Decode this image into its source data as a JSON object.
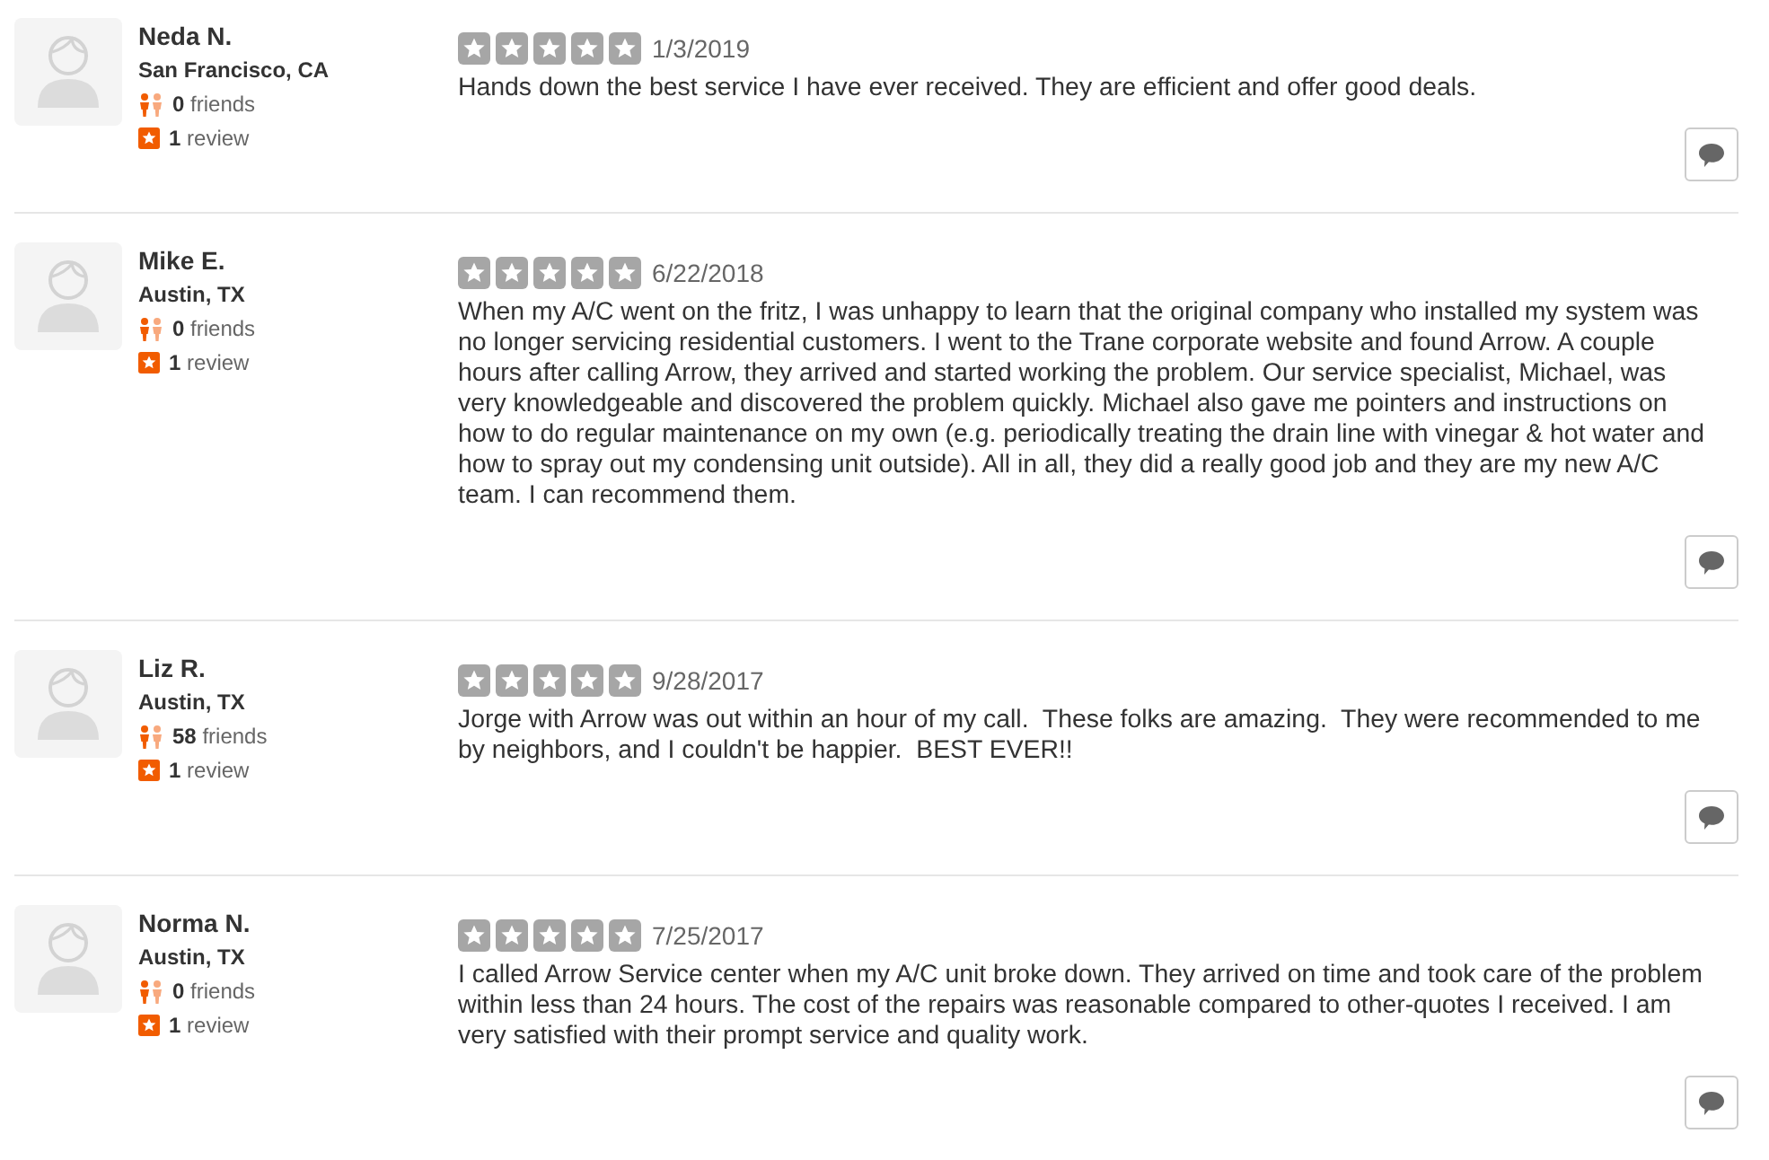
{
  "reviews": [
    {
      "user": {
        "name": "Neda N.",
        "location": "San Francisco, CA",
        "friends": "**0** friends",
        "reviews": "**1** review"
      },
      "stars": 0,
      "date": "1/3/2019",
      "text": "Hands down the best service I have ever received. They are efficient and offer good deals."
    },
    {
      "user": {
        "name": "Mike E.",
        "location": "Austin, TX",
        "friends": "**0** friends",
        "reviews": "**1** review"
      },
      "stars": 0,
      "date": "6/22/2018",
      "text": "When my A/C went on the fritz, I was unhappy to learn that the original company who installed my system was no longer servicing residential customers. I went to the Trane corporate website and found Arrow. A couple hours after calling Arrow, they arrived and started working the problem. Our service specialist, Michael, was very knowledgeable and discovered the problem quickly. Michael also gave me pointers and instructions on how to do regular maintenance on my own (e.g. periodically treating the drain line with vinegar & hot water and how to spray out my condensing unit outside). All in all, they did a really good job and they are my new A/C team. I can recommend them."
    },
    {
      "user": {
        "name": "Liz R.",
        "location": "Austin, TX",
        "friends": "**58** friends",
        "reviews": "**1** review"
      },
      "stars": 0,
      "date": "9/28/2017",
      "text": "Jorge with Arrow was out within an hour of my call.  These folks are amazing.  They were recommended to me by neighbors, and I couldn't be happier.  BEST EVER!!"
    },
    {
      "user": {
        "name": "Norma N.",
        "location": "Austin, TX",
        "friends": "**0** friends",
        "reviews": "**1** review"
      },
      "stars": 0,
      "date": "7/25/2017",
      "text": "I called Arrow Service center when my A/C unit broke down. They arrived on time and took care of the problem within less than 24 hours. The cost of the repairs was reasonable compared to other-quotes I received. I am very satisfied with their prompt service and quality work."
    }
  ]
}
